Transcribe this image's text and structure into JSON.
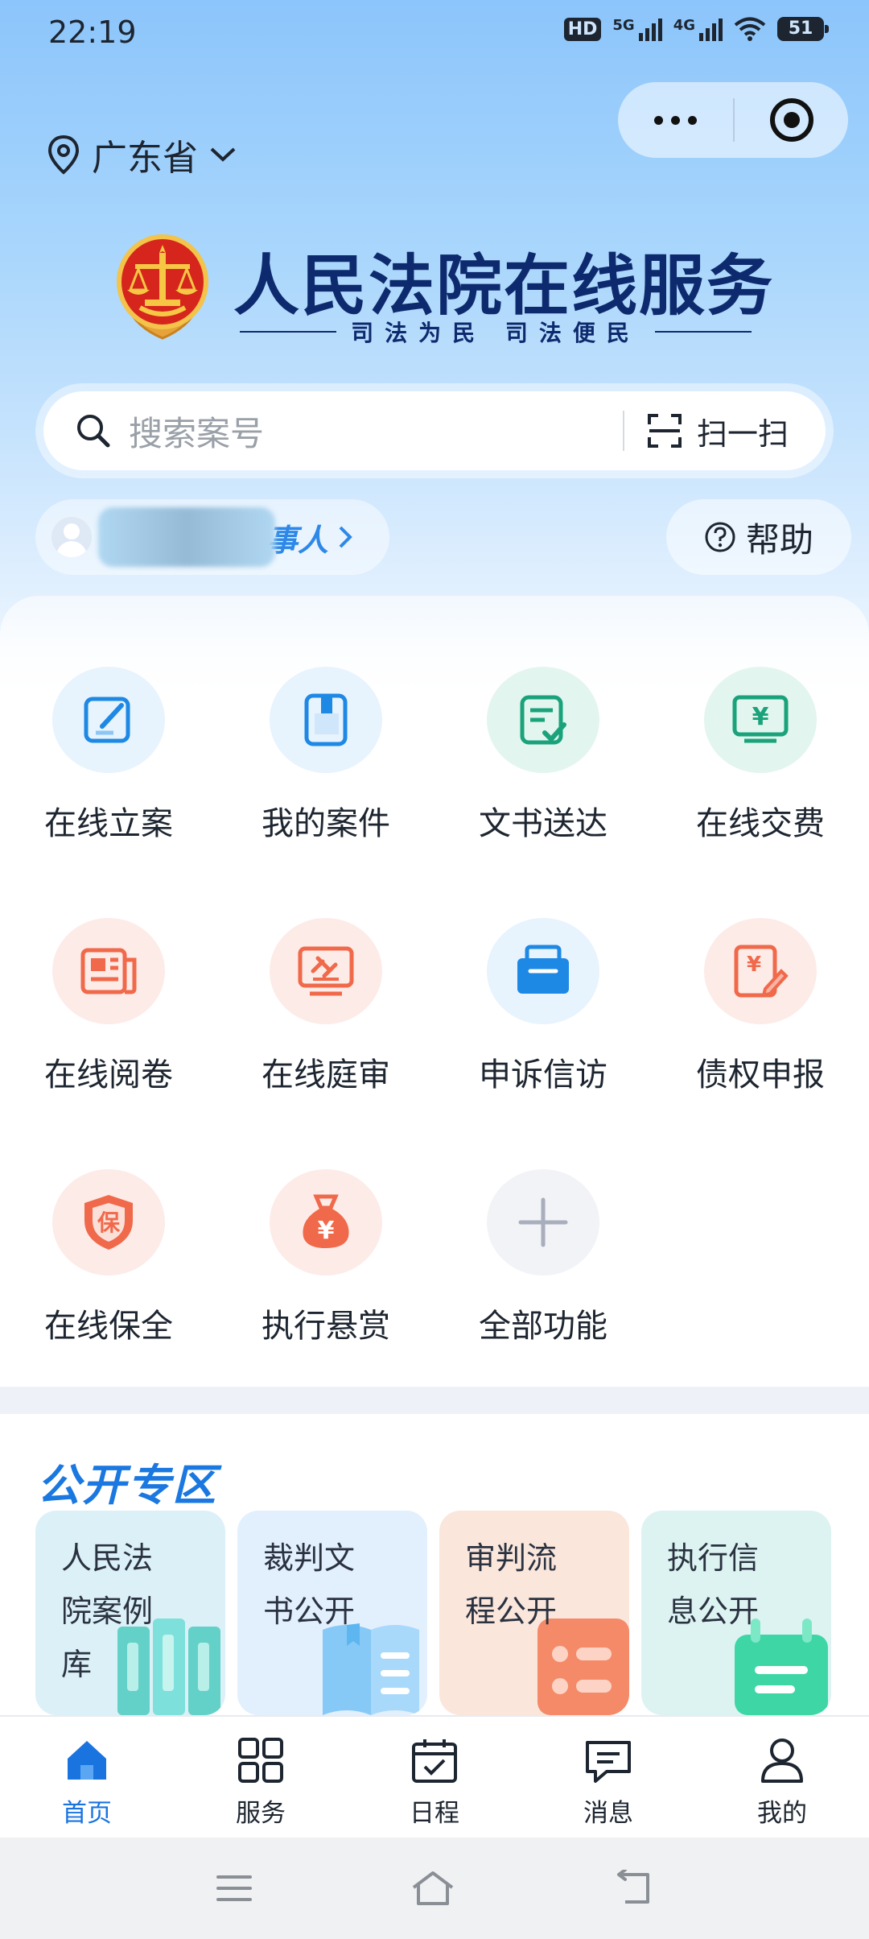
{
  "status_bar": {
    "time": "22:19",
    "hd": "HD",
    "sig1": "5G",
    "sig2": "4G",
    "battery": "51"
  },
  "location": {
    "province": "广东省"
  },
  "banner": {
    "title": "人民法院在线服务",
    "slogan": "司法为民 司法便民"
  },
  "search": {
    "placeholder": "搜索案号",
    "scan_label": "扫一扫"
  },
  "user": {
    "role_label": "事人"
  },
  "help": {
    "label": "帮助"
  },
  "functions": [
    {
      "label": "在线立案",
      "icon": "edit-doc-icon",
      "color": "#1e88e5"
    },
    {
      "label": "我的案件",
      "icon": "case-book-icon",
      "color": "#1e88e5"
    },
    {
      "label": "文书送达",
      "icon": "doc-check-icon",
      "color": "#1aa37a"
    },
    {
      "label": "在线交费",
      "icon": "payment-monitor-icon",
      "color": "#1aa37a"
    },
    {
      "label": "在线阅卷",
      "icon": "newspaper-icon",
      "color": "#f0694a"
    },
    {
      "label": "在线庭审",
      "icon": "gavel-screen-icon",
      "color": "#f0694a"
    },
    {
      "label": "申诉信访",
      "icon": "mailbox-icon",
      "color": "#1e88e5"
    },
    {
      "label": "债权申报",
      "icon": "claim-edit-icon",
      "color": "#f0694a"
    },
    {
      "label": "在线保全",
      "icon": "shield-icon",
      "color": "#f0694a"
    },
    {
      "label": "执行悬赏",
      "icon": "money-bag-icon",
      "color": "#f0694a"
    },
    {
      "label": "全部功能",
      "icon": "plus-icon",
      "color": "#a8aebb"
    }
  ],
  "shield_char": "保",
  "yen_char": "¥",
  "public_zone": {
    "title": "公开专区",
    "cards": [
      {
        "line1": "人民法",
        "line2": "院案例",
        "line3": "库"
      },
      {
        "line1": "裁判文",
        "line2": "书公开",
        "line3": ""
      },
      {
        "line1": "审判流",
        "line2": "程公开",
        "line3": ""
      },
      {
        "line1": "执行信",
        "line2": "息公开",
        "line3": ""
      }
    ]
  },
  "tabs": [
    {
      "label": "首页",
      "active": true
    },
    {
      "label": "服务",
      "active": false
    },
    {
      "label": "日程",
      "active": false
    },
    {
      "label": "消息",
      "active": false
    },
    {
      "label": "我的",
      "active": false
    }
  ],
  "colors": {
    "accent": "#1a74e0",
    "title_navy": "#0e2a6e",
    "blue": "#1e88e5",
    "green": "#1aa37a",
    "red": "#f0694a"
  }
}
